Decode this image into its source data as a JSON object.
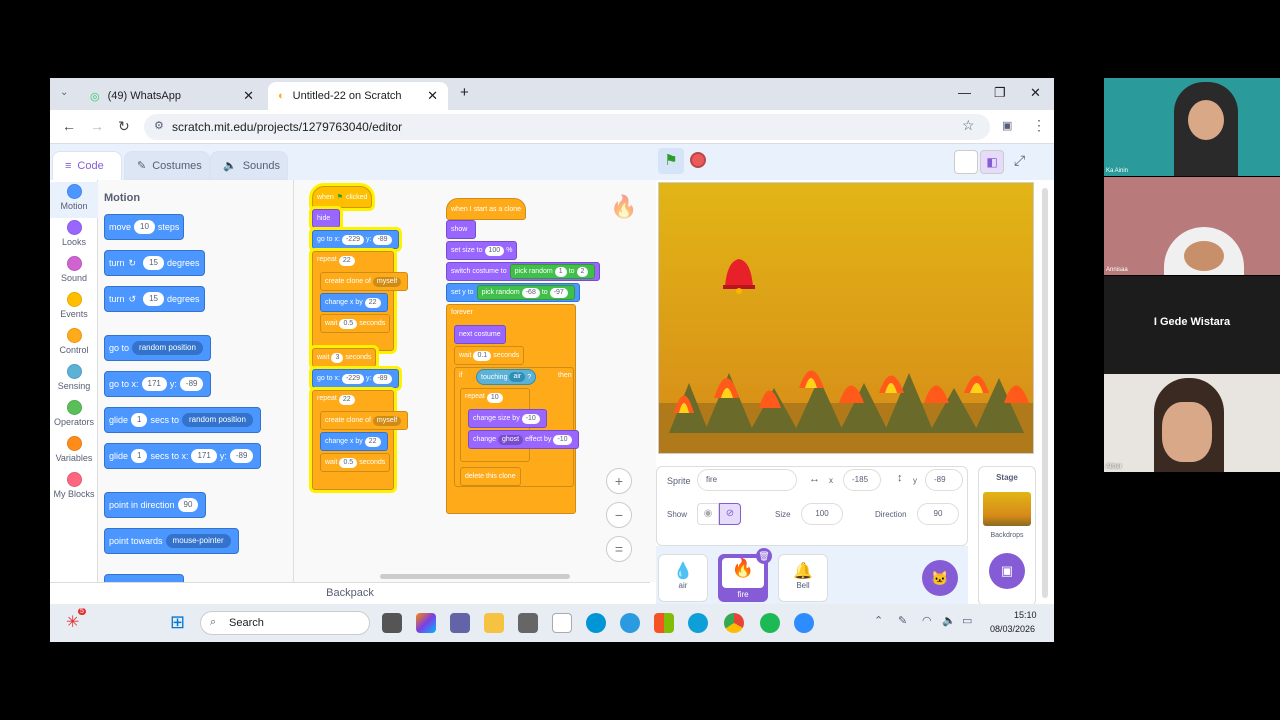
{
  "browser": {
    "tabs": [
      {
        "label": "(49) WhatsApp"
      },
      {
        "label": "Untitled-22 on Scratch"
      }
    ],
    "url": "scratch.mit.edu/projects/1279763040/editor"
  },
  "editor": {
    "tabs": {
      "code": "Code",
      "costumes": "Costumes",
      "sounds": "Sounds"
    },
    "categories": [
      {
        "label": "Motion",
        "color": "#4c97ff"
      },
      {
        "label": "Looks",
        "color": "#9966ff"
      },
      {
        "label": "Sound",
        "color": "#cf63cf"
      },
      {
        "label": "Events",
        "color": "#ffbf00"
      },
      {
        "label": "Control",
        "color": "#ffab19"
      },
      {
        "label": "Sensing",
        "color": "#5cb1d6"
      },
      {
        "label": "Operators",
        "color": "#59c059"
      },
      {
        "label": "Variables",
        "color": "#ff8c1a"
      },
      {
        "label": "My Blocks",
        "color": "#ff6680"
      }
    ],
    "palette_title": "Motion",
    "palette": {
      "move": "move",
      "steps": "steps",
      "ten": "10",
      "turn": "turn",
      "degrees": "degrees",
      "fifteen": "15",
      "goto": "go to",
      "random_position": "random position",
      "goto_x": "go to x:",
      "x171": "171",
      "y_label": "y:",
      "y89": "-89",
      "glide": "glide",
      "one": "1",
      "secs_to": "secs to",
      "secs_to_x": "secs to x:",
      "point_dir": "point in direction",
      "ninety": "90",
      "point_towards": "point towards",
      "mouse_pointer": "mouse-pointer"
    },
    "backpack": "Backpack"
  },
  "script1": {
    "when": "when",
    "clicked": "clicked",
    "hide": "hide",
    "goto": "go to x:",
    "x": "-229",
    "y": "y:",
    "yv": "-89",
    "repeat": "repeat",
    "r22": "22",
    "create_clone": "create clone of",
    "myself": "myself",
    "change_x": "change x by",
    "cx": "22",
    "wait": "wait",
    "w05": "0.5",
    "seconds": "seconds",
    "w3": "3"
  },
  "script2": {
    "hat": "when I start as a clone",
    "show": "show",
    "set_size": "set size to",
    "size": "100",
    "pct": "%",
    "switch": "switch costume to",
    "pick": "pick random",
    "p1": "1",
    "to": "to",
    "p2": "2",
    "set_y": "set y to",
    "py1": "-68",
    "py2": "-97",
    "forever": "forever",
    "next": "next costume",
    "wait": "wait",
    "w01": "0.1",
    "seconds": "seconds",
    "if": "if",
    "touching": "touching",
    "air": "air",
    "q": "?",
    "then": "then",
    "repeat": "repeat",
    "r10": "10",
    "change_size": "change size by",
    "cs": "-10",
    "change": "change",
    "ghost": "ghost",
    "effect": "effect by",
    "ev": "-10",
    "delete": "delete this clone"
  },
  "sprite": {
    "label": "Sprite",
    "name": "fire",
    "x_label": "x",
    "x": "-185",
    "y_label": "y",
    "y": "-89",
    "show": "Show",
    "size_label": "Size",
    "size": "100",
    "direction_label": "Direction",
    "direction": "90"
  },
  "sprites": [
    {
      "name": "air"
    },
    {
      "name": "fire"
    },
    {
      "name": "Bell"
    }
  ],
  "stage_panel": {
    "title": "Stage",
    "backdrops": "Backdrops"
  },
  "taskbar": {
    "search": "Search",
    "time": "15:10",
    "date": "08/03/2026",
    "badge": "5"
  },
  "participants": [
    {
      "name": "Ka Ainin"
    },
    {
      "name": "Annisaa"
    },
    {
      "name": "I Gede Wistara"
    },
    {
      "name": "Almer"
    }
  ]
}
